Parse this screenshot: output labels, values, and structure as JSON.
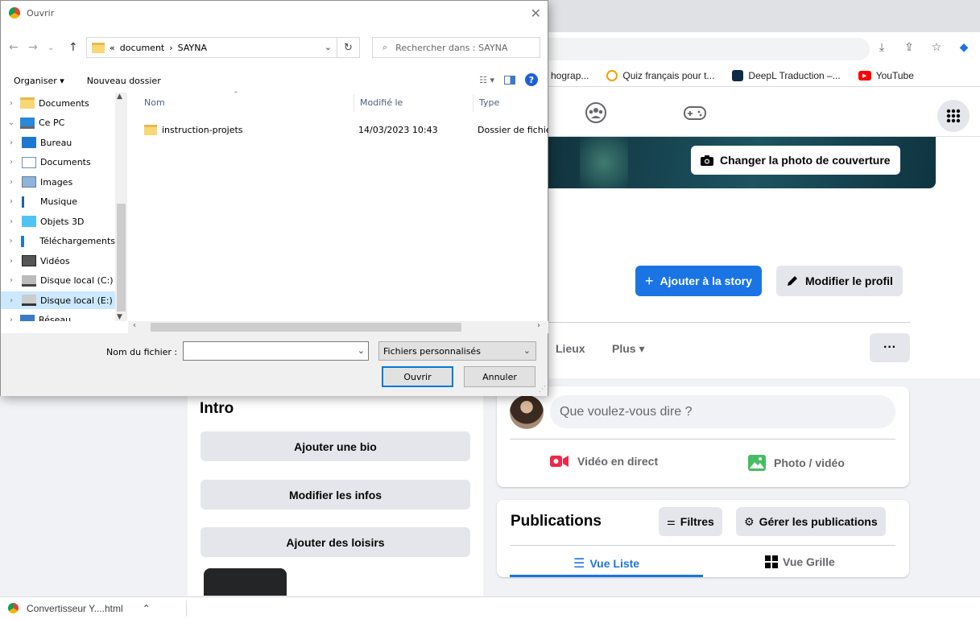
{
  "dialog": {
    "title": "Ouvrir",
    "path": [
      "document",
      "SAYNA"
    ],
    "path_prefix": "«",
    "path_sep": "›",
    "search_placeholder": "Rechercher dans : SAYNA",
    "toolbar": {
      "organiser": "Organiser ▾",
      "new_folder": "Nouveau dossier"
    },
    "tree": [
      {
        "label": "Documents",
        "icon": "folder-icon",
        "indent": 0,
        "exp": "›"
      },
      {
        "label": "Ce PC",
        "icon": "computer-icon",
        "indent": 0,
        "exp": "⌄"
      },
      {
        "label": "Bureau",
        "icon": "desktop-icon",
        "indent": 1,
        "exp": "›"
      },
      {
        "label": "Documents",
        "icon": "documents-icon",
        "indent": 1,
        "exp": "›"
      },
      {
        "label": "Images",
        "icon": "images-icon",
        "indent": 1,
        "exp": "›"
      },
      {
        "label": "Musique",
        "icon": "music-icon",
        "indent": 1,
        "exp": "›"
      },
      {
        "label": "Objets 3D",
        "icon": "objects3d-icon",
        "indent": 1,
        "exp": "›"
      },
      {
        "label": "Téléchargements",
        "icon": "download-icon",
        "indent": 1,
        "exp": "›"
      },
      {
        "label": "Vidéos",
        "icon": "videos-icon",
        "indent": 1,
        "exp": "›"
      },
      {
        "label": "Disque local (C:)",
        "icon": "drive-c-icon",
        "indent": 1,
        "exp": "›"
      },
      {
        "label": "Disque local (E:)",
        "icon": "drive-e-icon",
        "indent": 1,
        "exp": "›",
        "selected": true
      },
      {
        "label": "Réseau",
        "icon": "network-icon",
        "indent": 0,
        "exp": "›"
      }
    ],
    "columns": {
      "name": "Nom",
      "modified": "Modifié le",
      "type": "Type"
    },
    "files": [
      {
        "name": "instruction-projets",
        "modified": "14/03/2023 10:43",
        "type": "Dossier de fichiers"
      }
    ],
    "filename_label": "Nom du fichier :",
    "filename_value": "",
    "filetype": "Fichiers personnalisés",
    "open_label": "Ouvrir",
    "cancel_label": "Annuler"
  },
  "browser": {
    "bookmarks": [
      {
        "label": "hograp...",
        "icon": "none"
      },
      {
        "label": "Quiz français pour t...",
        "icon": "quiz-icon"
      },
      {
        "label": "DeepL Traduction –...",
        "icon": "deepl-icon"
      },
      {
        "label": "YouTube",
        "icon": "youtube-icon"
      }
    ],
    "download_item": "Convertisseur  Y....html"
  },
  "facebook": {
    "cover_button": "Changer la photo de couverture",
    "add_story": "Ajouter à la story",
    "add_story_prefix": "+",
    "edit_profile": "Modifier le profil",
    "tabs": {
      "places": "Lieux",
      "more": "Plus ▾"
    },
    "more_button": "···",
    "intro": {
      "title": "Intro",
      "buttons": [
        "Ajouter une bio",
        "Modifier les infos",
        "Ajouter des loisirs"
      ]
    },
    "composer": {
      "placeholder": "Que voulez-vous dire ?",
      "live": "Vidéo en direct",
      "photo": "Photo / vidéo"
    },
    "publications": {
      "title": "Publications",
      "filters": "Filtres",
      "manage": "Gérer les publications",
      "list_view": "Vue Liste",
      "grid_view": "Vue Grille"
    }
  },
  "colors": {
    "fb_blue": "#1b74e4",
    "dialog_selected": "#cce8ff",
    "live_red": "#f02849",
    "photo_green": "#45bd62"
  }
}
